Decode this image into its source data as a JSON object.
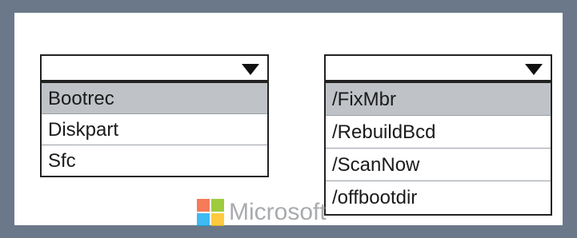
{
  "left_select": {
    "options": [
      "Bootrec",
      "Diskpart",
      "Sfc"
    ],
    "selected_index": 0
  },
  "right_select": {
    "options": [
      "/FixMbr",
      "/RebuildBcd",
      "/ScanNow",
      "/offbootdir"
    ],
    "selected_index": 0
  },
  "watermark": {
    "text": "Microsoft",
    "logo_colors": [
      "#f25022",
      "#7fba00",
      "#00a4ef",
      "#ffb900"
    ]
  }
}
